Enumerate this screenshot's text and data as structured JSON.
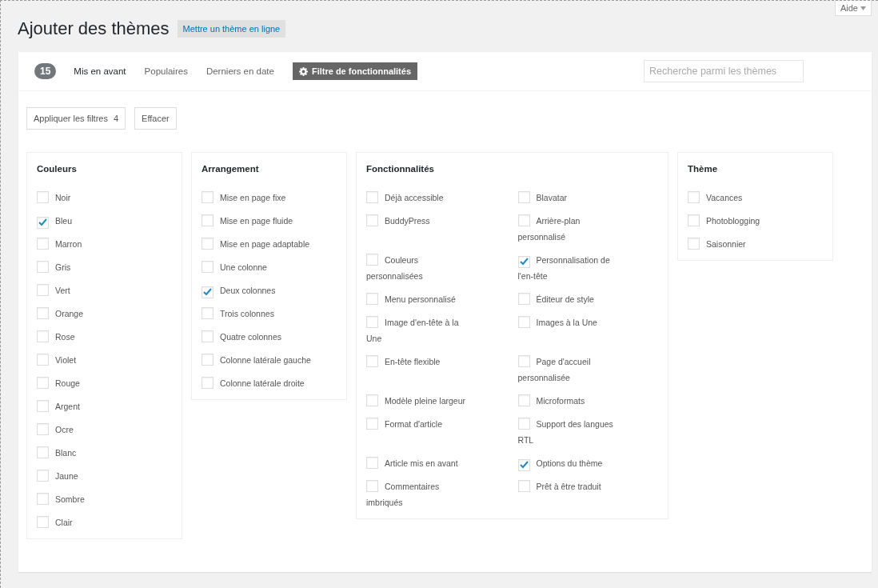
{
  "header": {
    "title": "Ajouter des thèmes",
    "upload_button": "Mettre un thème en ligne",
    "help": "Aide"
  },
  "filter_bar": {
    "count": "15",
    "tabs": [
      {
        "label": "Mis en avant",
        "selected": true
      },
      {
        "label": "Populaires",
        "selected": false
      },
      {
        "label": "Derniers en date",
        "selected": false
      }
    ],
    "feature_filter": {
      "label": "Filtre de fonctionnalités",
      "active": true
    },
    "search": {
      "placeholder": "Recherche parmi les thèmes"
    }
  },
  "actions": {
    "apply": {
      "label": "Appliquer les filtres",
      "count": "4"
    },
    "clear": "Effacer"
  },
  "groups": [
    {
      "title": "Couleurs",
      "kind": "list",
      "items": [
        {
          "label": "Noir",
          "checked": false
        },
        {
          "label": "Bleu",
          "checked": true
        },
        {
          "label": "Marron",
          "checked": false
        },
        {
          "label": "Gris",
          "checked": false
        },
        {
          "label": "Vert",
          "checked": false
        },
        {
          "label": "Orange",
          "checked": false
        },
        {
          "label": "Rose",
          "checked": false
        },
        {
          "label": "Violet",
          "checked": false
        },
        {
          "label": "Rouge",
          "checked": false
        },
        {
          "label": "Argent",
          "checked": false
        },
        {
          "label": "Ocre",
          "checked": false
        },
        {
          "label": "Blanc",
          "checked": false
        },
        {
          "label": "Jaune",
          "checked": false
        },
        {
          "label": "Sombre",
          "checked": false
        },
        {
          "label": "Clair",
          "checked": false
        }
      ]
    },
    {
      "title": "Arrangement",
      "kind": "list",
      "items": [
        {
          "label": "Mise en page fixe",
          "checked": false
        },
        {
          "label": "Mise en page fluide",
          "checked": false
        },
        {
          "label": "Mise en page adaptable",
          "checked": false
        },
        {
          "label": "Une colonne",
          "checked": false
        },
        {
          "label": "Deux colonnes",
          "checked": true
        },
        {
          "label": "Trois colonnes",
          "checked": false
        },
        {
          "label": "Quatre colonnes",
          "checked": false
        },
        {
          "label": "Colonne latérale gauche",
          "checked": false
        },
        {
          "label": "Colonne latérale droite",
          "checked": false
        }
      ]
    },
    {
      "title": "Fonctionnalités",
      "kind": "grid",
      "items": [
        {
          "label": "Déjà accessible",
          "checked": false
        },
        {
          "label": "Blavatar",
          "checked": false
        },
        {
          "label": "BuddyPress",
          "checked": false
        },
        {
          "label": "Arrière-plan personnalisé",
          "checked": false
        },
        {
          "label": "Couleurs personnalisées",
          "checked": false
        },
        {
          "label": "Personnalisation de l'en-tête",
          "checked": true
        },
        {
          "label": "Menu personnalisé",
          "checked": false
        },
        {
          "label": "Éditeur de style",
          "checked": false
        },
        {
          "label": "Image d'en-tête à la Une",
          "checked": false
        },
        {
          "label": "Images à la Une",
          "checked": false
        },
        {
          "label": "En-tête flexible",
          "checked": false
        },
        {
          "label": "Page d'accueil personnalisée",
          "checked": false
        },
        {
          "label": "Modèle pleine largeur",
          "checked": false
        },
        {
          "label": "Microformats",
          "checked": false
        },
        {
          "label": "Format d'article",
          "checked": false
        },
        {
          "label": "Support des langues RTL",
          "checked": false
        },
        {
          "label": "Article mis en avant",
          "checked": false
        },
        {
          "label": "Options du thème",
          "checked": true
        },
        {
          "label": "Commentaires imbriqués",
          "checked": false
        },
        {
          "label": "Prêt à être traduit",
          "checked": false
        }
      ]
    },
    {
      "title": "Thème",
      "kind": "list",
      "items": [
        {
          "label": "Vacances",
          "checked": false
        },
        {
          "label": "Photoblogging",
          "checked": false
        },
        {
          "label": "Saisonnier",
          "checked": false
        }
      ]
    }
  ]
}
